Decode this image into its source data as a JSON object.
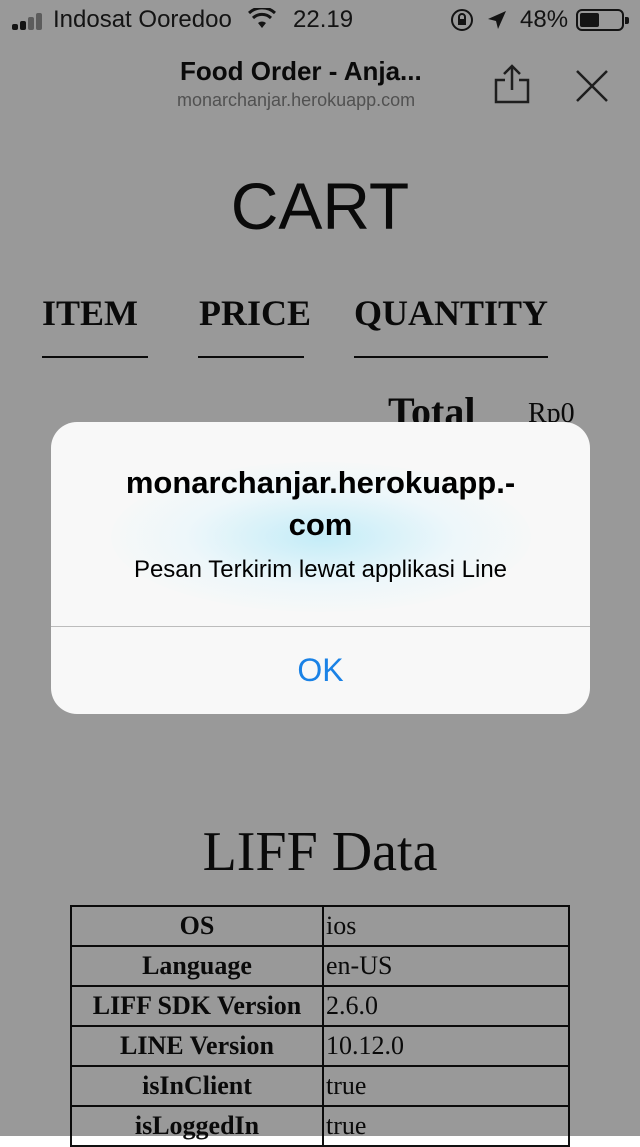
{
  "status_bar": {
    "carrier": "Indosat Ooredoo",
    "time": "22.19",
    "battery_percent": "48%",
    "battery_level": 0.48,
    "icons": [
      "signal-icon",
      "wifi-icon",
      "rotation-lock-icon",
      "location-icon",
      "battery-icon"
    ]
  },
  "nav": {
    "title": "Food Order - Anja...",
    "url": "monarchanjar.herokuapp.com",
    "icons": [
      "share-icon",
      "close-icon"
    ]
  },
  "cart": {
    "heading": "CART",
    "columns": [
      "ITEM",
      "PRICE",
      "QUANTITY"
    ],
    "total_label": "Total",
    "total_value": "Rp0"
  },
  "liff": {
    "heading": "LIFF Data",
    "rows": [
      {
        "key": "OS",
        "value": "ios"
      },
      {
        "key": "Language",
        "value": "en-US"
      },
      {
        "key": "LIFF SDK Version",
        "value": "2.6.0"
      },
      {
        "key": "LINE Version",
        "value": "10.12.0"
      },
      {
        "key": "isInClient",
        "value": "true"
      },
      {
        "key": "isLoggedIn",
        "value": "true"
      }
    ]
  },
  "alert": {
    "title": "monarchanjar.herokuapp.-\ncom",
    "message": "Pesan Terkirim lewat applikasi Line",
    "ok_label": "OK"
  },
  "colors": {
    "ok_blue": "#1a82e6",
    "overlay": "rgba(0,0,0,0.40)"
  }
}
